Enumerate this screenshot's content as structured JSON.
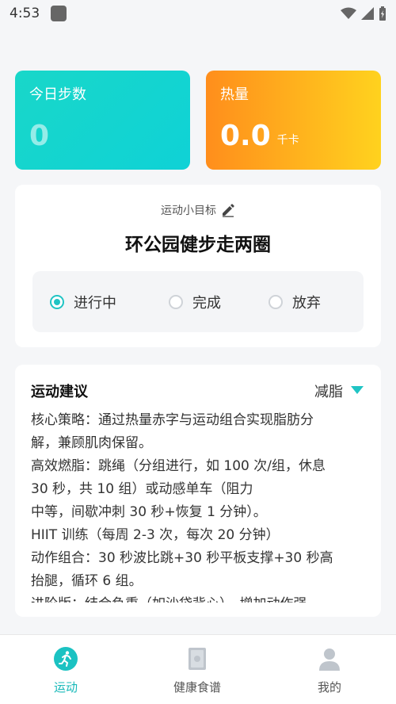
{
  "status_bar": {
    "time": "4:53"
  },
  "metrics": {
    "steps_label": "今日步数",
    "steps_value": "0",
    "calories_label": "热量",
    "calories_value": "0.0",
    "calories_unit": "千卡"
  },
  "goal": {
    "label": "运动小目标",
    "title": "环公园健步走两圈",
    "options": [
      "进行中",
      "完成",
      "放弃"
    ],
    "selected": "进行中"
  },
  "advice": {
    "title": "运动建议",
    "type": "减脂",
    "lines": [
      "核心策略：通过热量赤字与运动组合实现脂肪分",
      "解，兼顾肌肉保留。",
      "高效燃脂：跳绳（分组进行，如 100 次/组，休息",
      "30 秒，共 10 组）或动感单车（阻力",
      "中等，间歇冲刺 30 秒+恢复 1 分钟）。",
      "HIIT 训练（每周 2-3 次，每次 20 分钟）",
      "动作组合：30 秒波比跳+30 秒平板支撑+30 秒高",
      "抬腿，循环 6 组。",
      "进阶版：结合负重（如沙袋背心），增加动作强"
    ]
  },
  "nav": {
    "items": [
      "运动",
      "健康食谱",
      "我的"
    ],
    "active": "运动"
  },
  "colors": {
    "accent": "#17b9b9",
    "steps_card": "#19d7c9",
    "calories_card_start": "#ff8e1c",
    "calories_card_end": "#ffd21e"
  }
}
